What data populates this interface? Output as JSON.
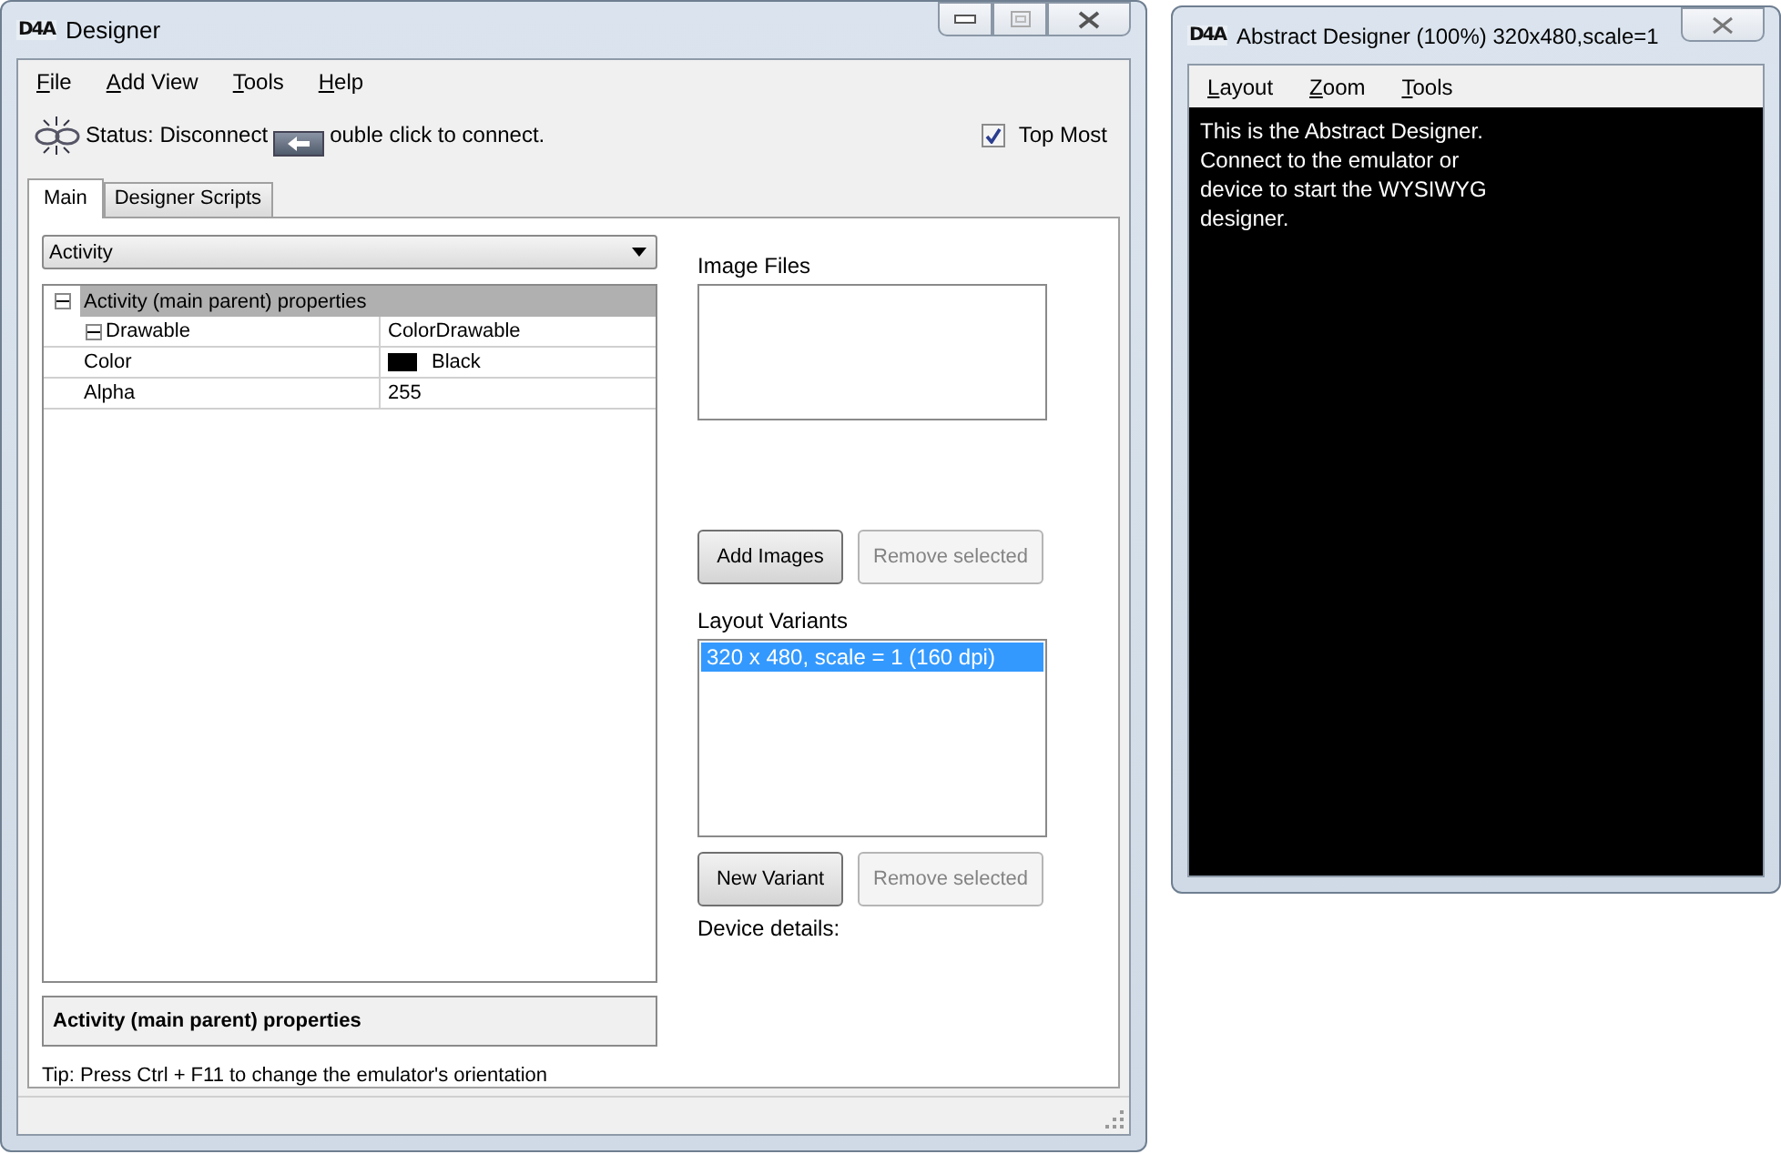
{
  "main_window": {
    "title": "Designer",
    "logo": "D4A",
    "menu": [
      {
        "label": "File"
      },
      {
        "label": "Add View"
      },
      {
        "label": "Tools"
      },
      {
        "label": "Help"
      }
    ],
    "status": {
      "text_before": "Status: Disconnect",
      "text_after": "ouble click to connect."
    },
    "top_most": {
      "label": "Top Most",
      "checked": true
    },
    "tabs": [
      {
        "label": "Main",
        "selected": true
      },
      {
        "label": "Designer Scripts",
        "selected": false
      }
    ],
    "module_dropdown": {
      "value": "Activity"
    },
    "property_grid": [
      {
        "kind": "category",
        "label": "Activity (main parent) properties",
        "expanded": true,
        "children": [
          {
            "kind": "property",
            "label": "Drawable",
            "value": "ColorDrawable",
            "expanded": true,
            "children": [
              {
                "kind": "color",
                "label": "Color",
                "value": "Black",
                "color": "#000000"
              },
              {
                "kind": "property",
                "label": "Alpha",
                "value": "255"
              }
            ]
          }
        ]
      }
    ],
    "description": "Activity (main parent) properties",
    "tip": "Tip: Press Ctrl + F11 to change the emulator's orientation",
    "image_files": {
      "label": "Image Files",
      "add_button": "Add Images",
      "remove_button": {
        "label": "Remove selected",
        "disabled": true
      }
    },
    "layout_variants": {
      "label": "Layout Variants",
      "items": [
        {
          "label": "320 x 480, scale = 1 (160 dpi)",
          "selected": true
        }
      ],
      "new_button": "New Variant",
      "remove_button": {
        "label": "Remove selected",
        "disabled": true
      }
    },
    "device_details": "Device details:"
  },
  "abstract_window": {
    "title": "Abstract Designer (100%) 320x480,scale=1",
    "logo": "D4A",
    "menu": [
      {
        "label": "Layout"
      },
      {
        "label": "Zoom"
      },
      {
        "label": "Tools"
      }
    ],
    "message": "This is the Abstract Designer. Connect to the emulator or device to start the WYSIWYG designer."
  }
}
